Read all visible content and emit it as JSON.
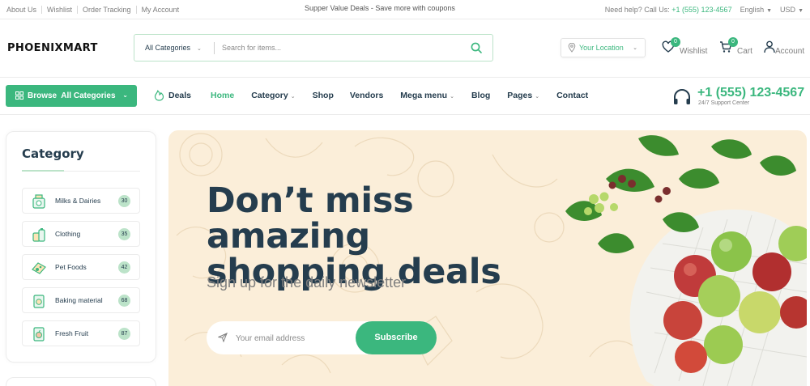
{
  "topbar": {
    "links": [
      "About Us",
      "Wishlist",
      "Order Tracking",
      "My Account"
    ],
    "promo": "Supper Value Deals - Save more with coupons",
    "help_prefix": "Need help? Call Us: ",
    "help_phone": "+1 (555) 123-4567",
    "language": "English",
    "currency": "USD"
  },
  "header": {
    "logo": "PHOENIXMART",
    "search": {
      "category": "All Categories",
      "placeholder": "Search for items..."
    },
    "location": "Your Location",
    "wishlist": {
      "label": "Wishlist",
      "count": "0"
    },
    "cart": {
      "label": "Cart",
      "count": "0"
    },
    "account": {
      "label": "Account"
    }
  },
  "nav": {
    "browse_label": "Browse  All Categories",
    "deals": "Deals",
    "links": [
      {
        "label": "Home",
        "active": true,
        "caret": false
      },
      {
        "label": "Category",
        "active": false,
        "caret": true
      },
      {
        "label": "Shop",
        "active": false,
        "caret": false
      },
      {
        "label": "Vendors",
        "active": false,
        "caret": false
      },
      {
        "label": "Mega menu",
        "active": false,
        "caret": true
      },
      {
        "label": "Blog",
        "active": false,
        "caret": false
      },
      {
        "label": "Pages",
        "active": false,
        "caret": true
      },
      {
        "label": "Contact",
        "active": false,
        "caret": false
      }
    ],
    "hotline": {
      "number": "+1 (555) 123-4567",
      "sub": "24/7 Support Center"
    }
  },
  "sidebar": {
    "title": "Category",
    "items": [
      {
        "label": "Milks & Dairies",
        "count": "30",
        "icon": "milk-icon"
      },
      {
        "label": "Clothing",
        "count": "35",
        "icon": "clothing-icon"
      },
      {
        "label": "Pet Foods",
        "count": "42",
        "icon": "pet-food-icon"
      },
      {
        "label": "Baking material",
        "count": "68",
        "icon": "baking-icon"
      },
      {
        "label": "Fresh Fruit",
        "count": "87",
        "icon": "fruit-icon"
      }
    ]
  },
  "hero": {
    "title_line1": "Don’t miss amazing",
    "title_line2": "shopping deals",
    "subtitle": "Sign up for the daily newsletter",
    "email_placeholder": "Your email address",
    "subscribe": "Subscribe"
  },
  "colors": {
    "brand": "#3bb77e",
    "heading": "#253d4e",
    "muted": "#7e7e7e",
    "hero_bg": "#fbeed9",
    "badge_bg": "#bce3c9"
  }
}
